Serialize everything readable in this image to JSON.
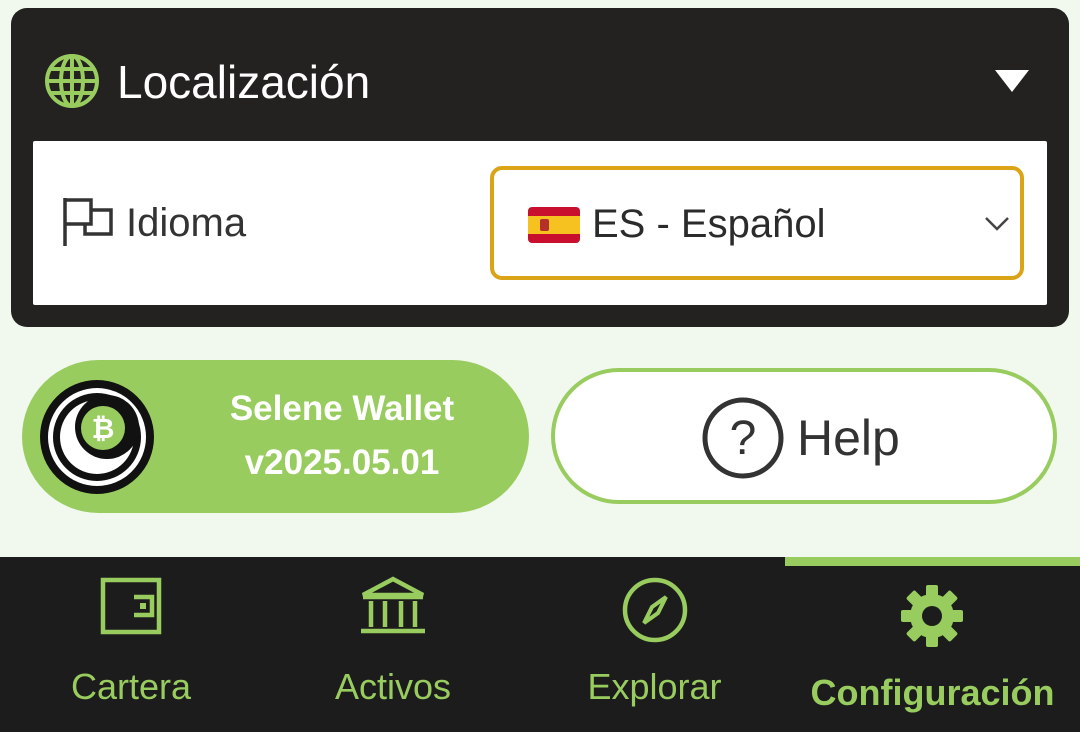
{
  "localization": {
    "title": "Localización",
    "language_label": "Idioma",
    "language_value": "ES - Español"
  },
  "wallet": {
    "name": "Selene Wallet",
    "version": "v2025.05.01"
  },
  "help": {
    "label": "Help"
  },
  "nav": {
    "items": [
      {
        "label": "Cartera",
        "icon": "wallet-icon"
      },
      {
        "label": "Activos",
        "icon": "bank-icon"
      },
      {
        "label": "Explorar",
        "icon": "compass-icon"
      },
      {
        "label": "Configuración",
        "icon": "gear-icon"
      }
    ],
    "active_index": 3
  },
  "colors": {
    "accent": "#99cc5f",
    "card_bg": "#232220",
    "select_border": "#dba417",
    "page_bg": "#f1f8ee",
    "nav_bg": "#1c1c1c"
  }
}
